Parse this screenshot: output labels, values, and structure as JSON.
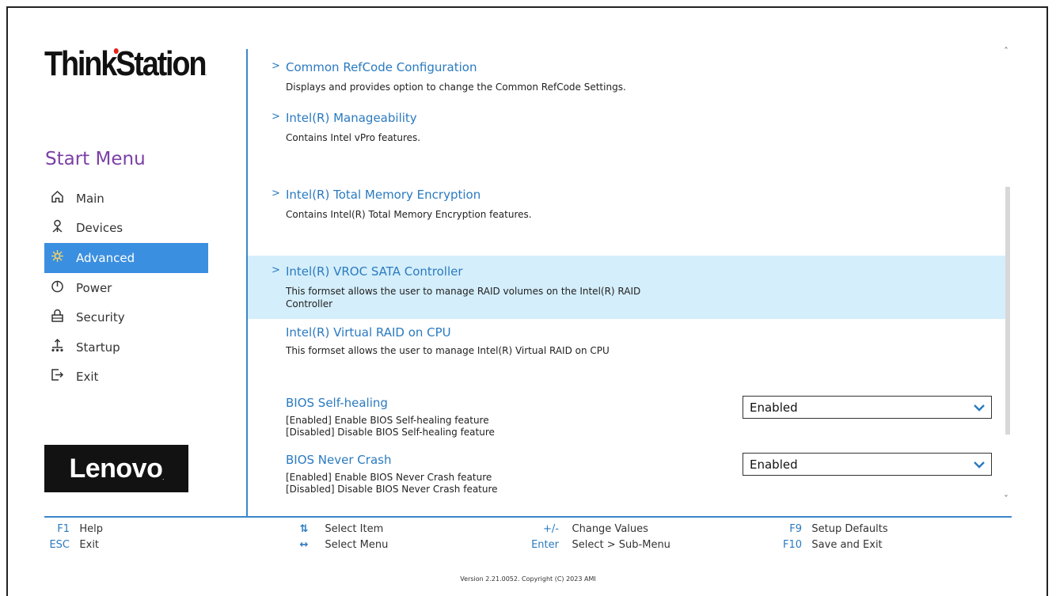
{
  "brand": {
    "product": "ThinkStation",
    "vendor": "Lenovo"
  },
  "sidebar": {
    "heading": "Start Menu",
    "items": [
      {
        "label": "Main",
        "icon": "home-icon"
      },
      {
        "label": "Devices",
        "icon": "devices-icon"
      },
      {
        "label": "Advanced",
        "icon": "advanced-icon",
        "active": true
      },
      {
        "label": "Power",
        "icon": "power-icon"
      },
      {
        "label": "Security",
        "icon": "lock-icon"
      },
      {
        "label": "Startup",
        "icon": "startup-icon"
      },
      {
        "label": "Exit",
        "icon": "exit-icon"
      }
    ]
  },
  "content": {
    "entries": [
      {
        "title": "Common RefCode Configuration",
        "desc": "Displays and provides option to change the Common RefCode Settings.",
        "submenu": true
      },
      {
        "title": "Intel(R) Manageability",
        "desc": "Contains Intel vPro features.",
        "submenu": true
      },
      {
        "title": "Intel(R) Total Memory Encryption",
        "desc": "Contains Intel(R) Total Memory Encryption features.",
        "submenu": true
      },
      {
        "title": "Intel(R) VROC SATA Controller",
        "desc": "This formset allows the user to manage RAID volumes on the Intel(R) RAID Controller",
        "submenu": true,
        "highlighted": true
      },
      {
        "title": "Intel(R) Virtual RAID on CPU",
        "desc": "This formset allows the user to manage Intel(R) Virtual RAID on CPU",
        "submenu": false
      }
    ],
    "settings": [
      {
        "title": "BIOS Self-healing",
        "desc_lines": [
          "[Enabled] Enable BIOS Self-healing feature",
          "[Disabled] Disable BIOS Self-healing feature"
        ],
        "value": "Enabled"
      },
      {
        "title": "BIOS Never Crash",
        "desc_lines": [
          "[Enabled] Enable BIOS Never Crash feature",
          "[Disabled] Disable BIOS Never Crash feature"
        ],
        "value": "Enabled"
      }
    ]
  },
  "help": [
    {
      "key": "F1",
      "label": "Help"
    },
    {
      "key": "ESC",
      "label": "Exit"
    },
    {
      "key": "⇅",
      "label": "Select Item"
    },
    {
      "key": "↔",
      "label": "Select Menu"
    },
    {
      "key": "+/-",
      "label": "Change Values"
    },
    {
      "key": "Enter",
      "label": "Select > Sub-Menu"
    },
    {
      "key": "F9",
      "label": "Setup Defaults"
    },
    {
      "key": "F10",
      "label": "Save and Exit"
    }
  ],
  "footer": {
    "version": "Version 2.21.0052. Copyright (C) 2023 AMI"
  },
  "colors": {
    "accent": "#3b8fe0",
    "link": "#2a7ac0",
    "heading": "#7b3fa5",
    "highlight": "#d4eefb",
    "divider": "#3a86c8"
  }
}
